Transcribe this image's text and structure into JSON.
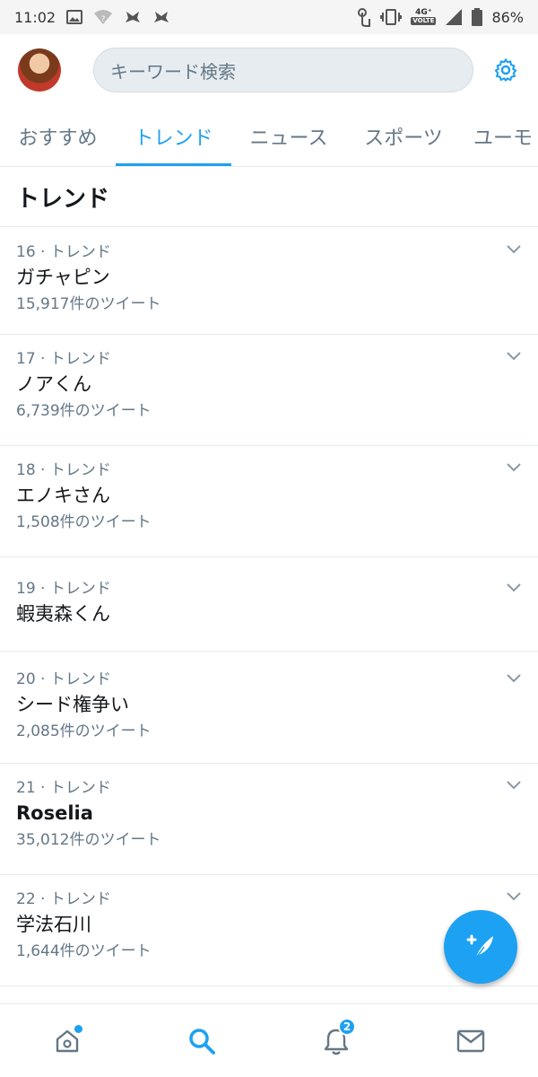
{
  "status_bar": {
    "time": "11:02",
    "network": "4G⁺",
    "volte": "VOLTE",
    "battery": "86%"
  },
  "header": {
    "search_placeholder": "キーワード検索"
  },
  "tabs": [
    {
      "label": "おすすめ",
      "active": false
    },
    {
      "label": "トレンド",
      "active": true
    },
    {
      "label": "ニュース",
      "active": false
    },
    {
      "label": "スポーツ",
      "active": false
    },
    {
      "label": "ユーモ",
      "active": false
    }
  ],
  "section_title": "トレンド",
  "trends": [
    {
      "meta": "16 · トレンド",
      "name": "ガチャピン",
      "count": "15,917件のツイート"
    },
    {
      "meta": "17 · トレンド",
      "name": "ノアくん",
      "count": "6,739件のツイート"
    },
    {
      "meta": "18 · トレンド",
      "name": "エノキさん",
      "count": "1,508件のツイート"
    },
    {
      "meta": "19 · トレンド",
      "name": "蝦夷森くん",
      "count": ""
    },
    {
      "meta": "20 · トレンド",
      "name": "シード権争い",
      "count": "2,085件のツイート"
    },
    {
      "meta": "21 · トレンド",
      "name": "Roselia",
      "count": "35,012件のツイート"
    },
    {
      "meta": "22 · トレンド",
      "name": "学法石川",
      "count": "1,644件のツイート"
    }
  ],
  "bottom_nav": {
    "notifications_badge": "2"
  },
  "colors": {
    "accent": "#1da1f2",
    "text": "#14171a",
    "secondary": "#657786",
    "divider": "#e6ecf0"
  }
}
